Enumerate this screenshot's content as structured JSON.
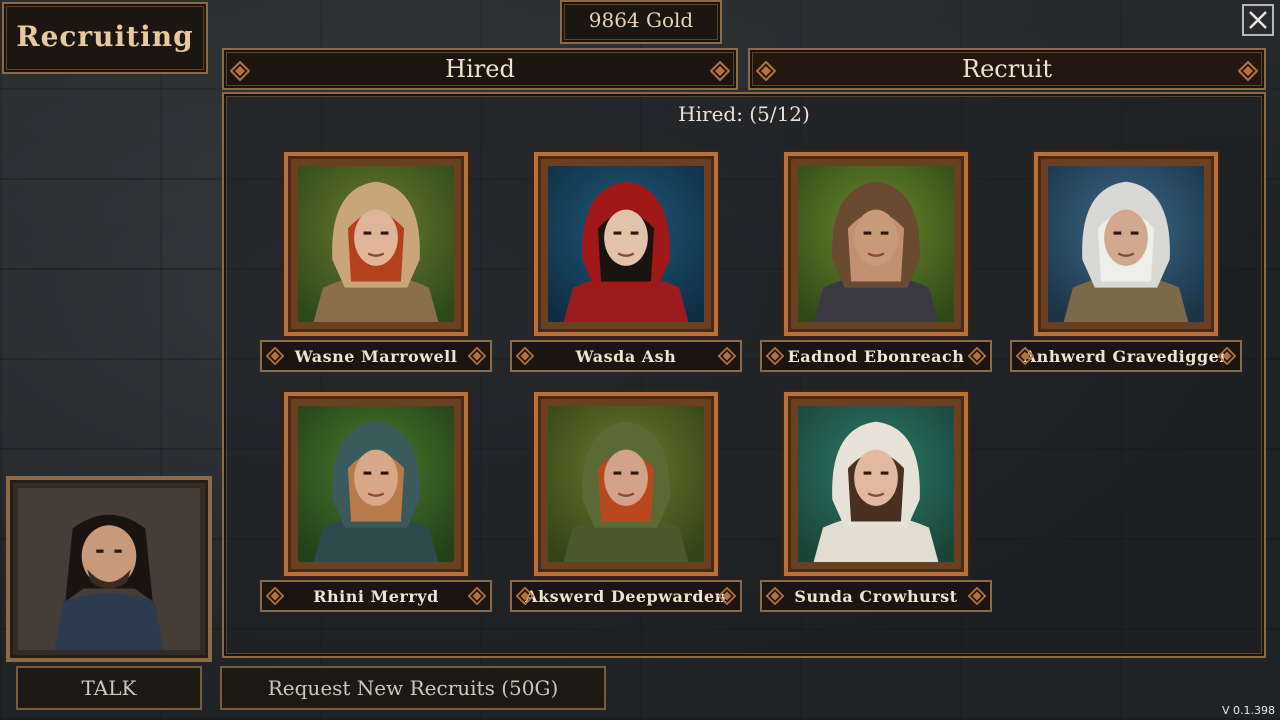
{
  "header": {
    "title": "Recruiting",
    "gold": "9864 Gold",
    "close_icon": "close-icon"
  },
  "tabs": [
    {
      "label": "Hired",
      "active": false
    },
    {
      "label": "Recruit",
      "active": true
    }
  ],
  "panel": {
    "hired_count": "Hired: (5/12)"
  },
  "recruits": [
    {
      "name": "Wasne Marrowell"
    },
    {
      "name": "Wasda Ash"
    },
    {
      "name": "Eadnod Ebonreach"
    },
    {
      "name": "Anhwerd Gravedigger"
    },
    {
      "name": "Rhini Merryd"
    },
    {
      "name": "Akswerd Deepwarden"
    },
    {
      "name": "Sunda Crowhurst"
    }
  ],
  "footer": {
    "talk_label": "TALK",
    "request_label": "Request New Recruits (50G)",
    "version": "V 0.1.398"
  },
  "colors": {
    "frame": "#b7713a",
    "border_bronze": "#8c6a45",
    "text": "#efe3cf"
  }
}
